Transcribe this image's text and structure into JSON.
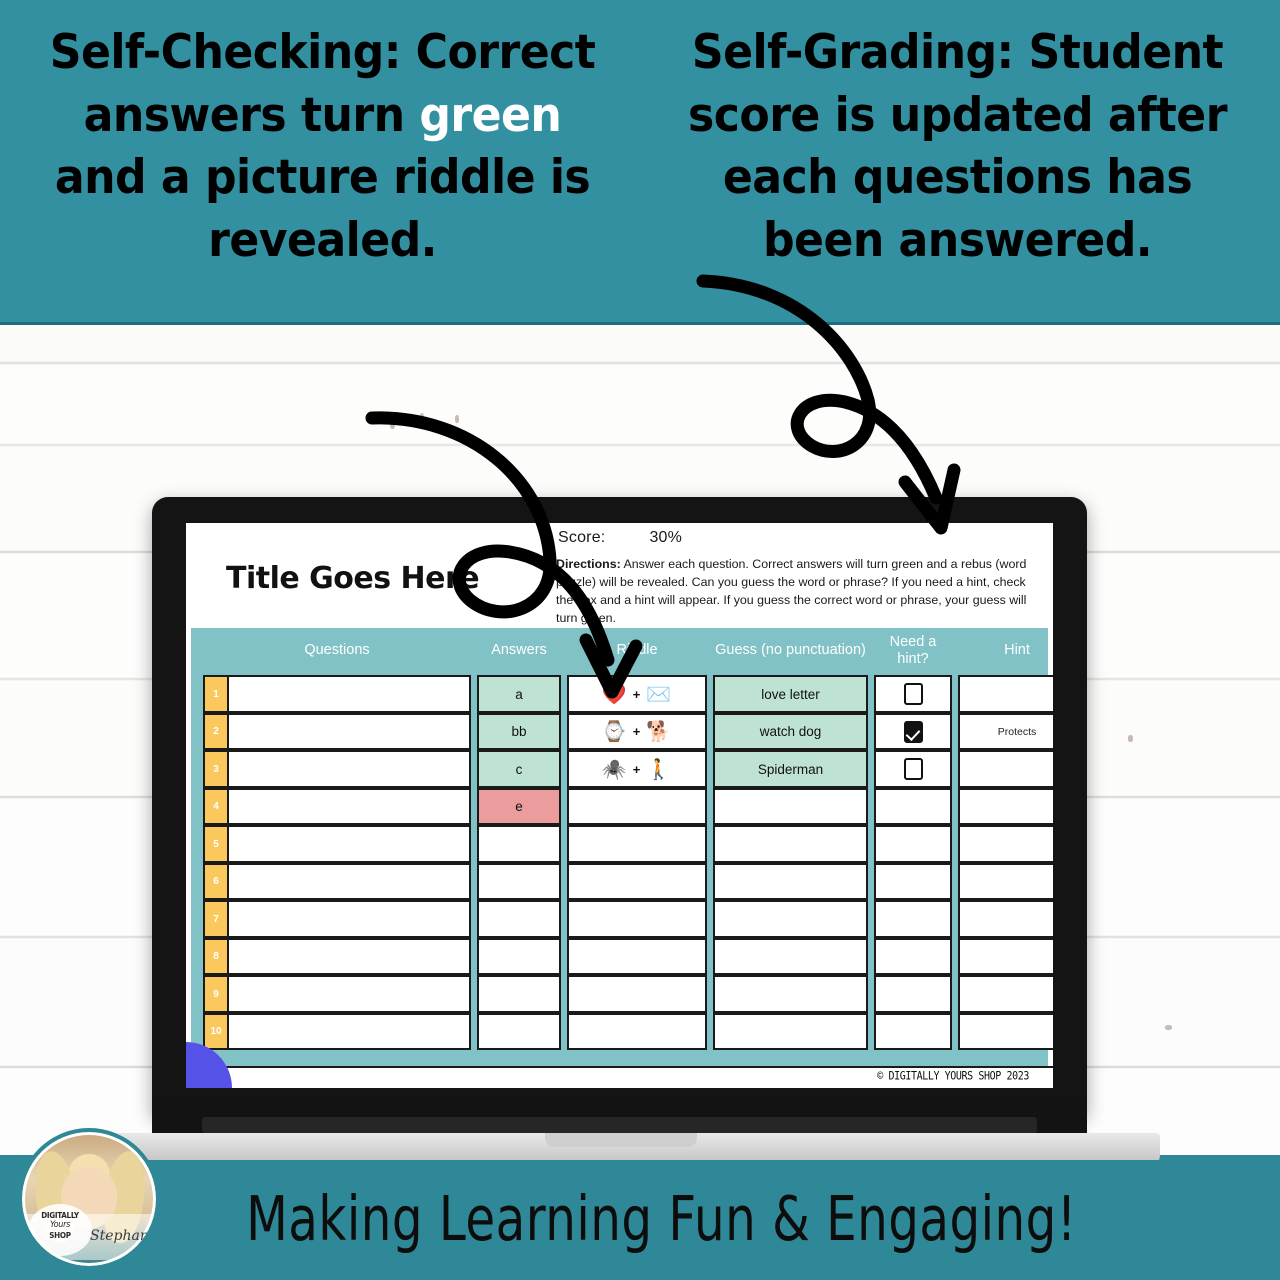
{
  "top_banner": {
    "left_text_parts": [
      "Self-Checking: Correct answers turn ",
      "green",
      " and a picture riddle is revealed."
    ],
    "left_pre": "Self-Checking: Correct answers turn ",
    "left_highlight": "green",
    "left_post": " and a picture riddle is revealed.",
    "right_text": "Self-Grading: Student score is updated after each questions has been answered.",
    "bg_color": "#3290a0",
    "highlight_color": "#ffffff"
  },
  "slide": {
    "title": "Title Goes Here",
    "score_label": "Score:",
    "score_value": "30%",
    "directions_label": "Directions:",
    "directions_body": "Answer each question.  Correct answers will turn green and a rebus (word puzzle) will be revealed.  Can you guess the word or phrase? If you need a hint, check the box and a hint will appear.  If you guess the correct word or phrase, your guess will turn green.",
    "copyright": "© DIGITALLY YOURS SHOP 2023",
    "header_bg": "#81c2c6",
    "correct_color": "#bfe3d2",
    "incorrect_color": "#eb9c9c",
    "rownum_color": "#fbc85e",
    "corner_color": "#5552e8",
    "columns": [
      "Questions",
      "Answers",
      "Riddle",
      "Guess (no punctuation)",
      "Need a hint?",
      "Hint"
    ],
    "rows": [
      {
        "num": "1",
        "question": "",
        "answer": "a",
        "answer_state": "correct",
        "riddle": [
          "❤️",
          "✉️"
        ],
        "guess": "love letter",
        "guess_state": "correct",
        "hint_checked": false,
        "hint": ""
      },
      {
        "num": "2",
        "question": "",
        "answer": "bb",
        "answer_state": "correct",
        "riddle": [
          "⌚",
          "🐕"
        ],
        "guess": "watch dog",
        "guess_state": "correct",
        "hint_checked": true,
        "hint": "Protects"
      },
      {
        "num": "3",
        "question": "",
        "answer": "c",
        "answer_state": "correct",
        "riddle": [
          "🕷️",
          "🚶"
        ],
        "guess": "Spiderman",
        "guess_state": "correct",
        "hint_checked": false,
        "hint": ""
      },
      {
        "num": "4",
        "question": "",
        "answer": "e",
        "answer_state": "incorrect",
        "riddle": [],
        "guess": "",
        "guess_state": "empty",
        "hint_checked": null,
        "hint": ""
      },
      {
        "num": "5",
        "question": "",
        "answer": "",
        "answer_state": "empty",
        "riddle": [],
        "guess": "",
        "guess_state": "empty",
        "hint_checked": null,
        "hint": ""
      },
      {
        "num": "6",
        "question": "",
        "answer": "",
        "answer_state": "empty",
        "riddle": [],
        "guess": "",
        "guess_state": "empty",
        "hint_checked": null,
        "hint": ""
      },
      {
        "num": "7",
        "question": "",
        "answer": "",
        "answer_state": "empty",
        "riddle": [],
        "guess": "",
        "guess_state": "empty",
        "hint_checked": null,
        "hint": ""
      },
      {
        "num": "8",
        "question": "",
        "answer": "",
        "answer_state": "empty",
        "riddle": [],
        "guess": "",
        "guess_state": "empty",
        "hint_checked": null,
        "hint": ""
      },
      {
        "num": "9",
        "question": "",
        "answer": "",
        "answer_state": "empty",
        "riddle": [],
        "guess": "",
        "guess_state": "empty",
        "hint_checked": null,
        "hint": ""
      },
      {
        "num": "10",
        "question": "",
        "answer": "",
        "answer_state": "empty",
        "riddle": [],
        "guess": "",
        "guess_state": "empty",
        "hint_checked": null,
        "hint": ""
      }
    ]
  },
  "annotations": {
    "left_arrow": "curved-arrow-to-riddle-column",
    "right_arrow": "curved-arrow-to-score"
  },
  "bottom_banner": {
    "tagline": "Making Learning Fun & Engaging!",
    "bg_color": "#2e8897",
    "logo_line1": "DIGITALLY",
    "logo_line2": "Yours",
    "logo_line3": "SHOP",
    "signature": "Stephani"
  }
}
